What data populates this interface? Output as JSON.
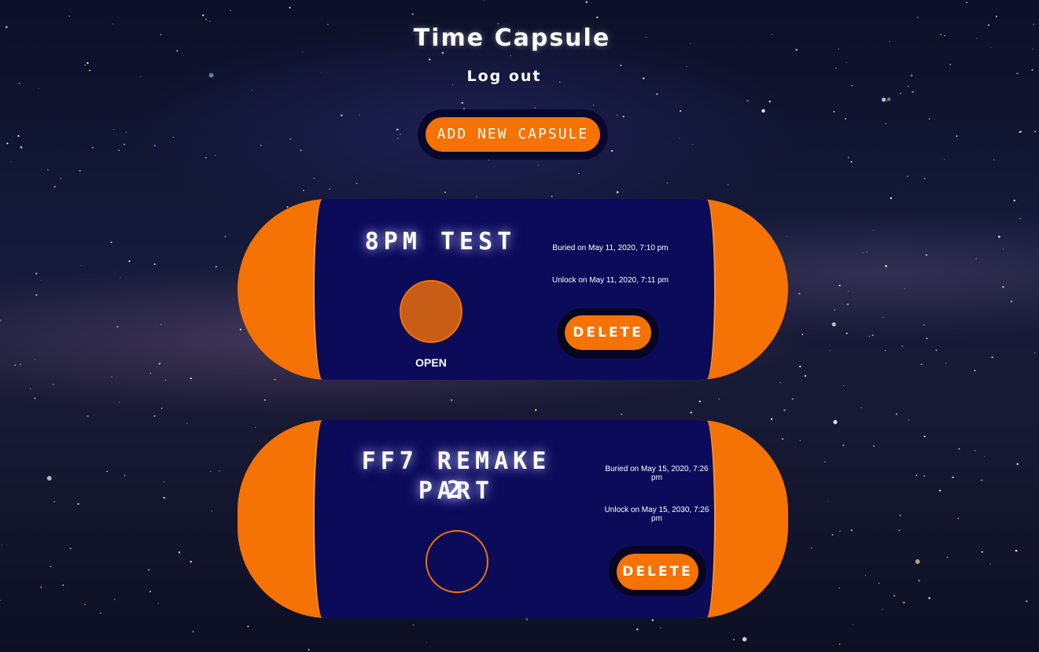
{
  "header": {
    "title": "Time Capsule",
    "logout_label": "Log out"
  },
  "actions": {
    "add_label": "ADD NEW CAPSULE"
  },
  "capsules": [
    {
      "title": "8PM TEST",
      "buried": "Buried on May 11, 2020, 7:10 pm",
      "unlock": "Unlock on May 11, 2020, 7:11 pm",
      "open_label": "OPEN",
      "delete_label": "DELETE",
      "unlocked": true
    },
    {
      "title_line1": "FF7 REMAKE PART",
      "title_line2": "2",
      "buried_line1": "Buried on May 15, 2020, 7:26",
      "buried_line2": "pm",
      "unlock_line1": "Unlock on May 15, 2030, 7:26",
      "unlock_line2": "pm",
      "delete_label": "DELETE",
      "unlocked": false
    }
  ],
  "colors": {
    "accent": "#f57205",
    "capsule_inner": "#0c0b5a",
    "button_shadow": "#08082e"
  }
}
